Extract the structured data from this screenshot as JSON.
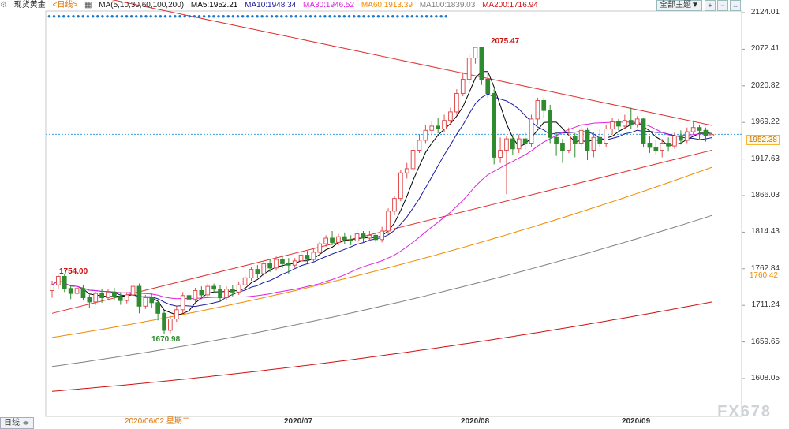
{
  "header": {
    "symbol": "现货黄金",
    "period": "<日线>",
    "ma_label": "MA(5,10,30,60,100,200)",
    "ma5": "MA5:1952.21",
    "ma10": "MA10:1948.34",
    "ma30": "MA30:1946.52",
    "ma60": "MA60:1913.39",
    "ma100": "MA100:1839.03",
    "ma200": "MA200:1716.94",
    "theme_button": "全部主题▼",
    "colors": {
      "ma5": "#000000",
      "ma10": "#1a1aa0",
      "ma30": "#e020e0",
      "ma60": "#f08a00",
      "ma100": "#808080",
      "ma200": "#d01010",
      "up": "#e05050",
      "down": "#2e8b2e"
    }
  },
  "chart_data": {
    "type": "candlestick",
    "y_ticks": [
      "2124.01",
      "2072.41",
      "2020.82",
      "1969.22",
      "1917.63",
      "1866.03",
      "1814.43",
      "1762.84",
      "1711.24",
      "1659.65",
      "1608.05"
    ],
    "ylim": [
      1608.05,
      2124.01
    ],
    "x_labels": [
      "2020/07",
      "2020/08",
      "2020/09"
    ],
    "cursor_date": "2020/06/02 星期二",
    "current_price": "1952.38",
    "ma60_tag": "1760.42",
    "annotations": {
      "high": "2075.47",
      "low": "1670.98",
      "local_high": "1754.00"
    },
    "candles": [
      [
        1732,
        1740,
        1722,
        1746
      ],
      [
        1740,
        1752,
        1735,
        1754
      ],
      [
        1752,
        1735,
        1730,
        1755
      ],
      [
        1735,
        1728,
        1720,
        1740
      ],
      [
        1728,
        1735,
        1722,
        1740
      ],
      [
        1735,
        1722,
        1718,
        1740
      ],
      [
        1722,
        1716,
        1708,
        1726
      ],
      [
        1716,
        1728,
        1712,
        1730
      ],
      [
        1728,
        1722,
        1715,
        1734
      ],
      [
        1722,
        1730,
        1718,
        1734
      ],
      [
        1730,
        1724,
        1718,
        1736
      ],
      [
        1724,
        1718,
        1712,
        1730
      ],
      [
        1718,
        1726,
        1714,
        1730
      ],
      [
        1726,
        1738,
        1722,
        1742
      ],
      [
        1738,
        1710,
        1700,
        1742
      ],
      [
        1710,
        1722,
        1706,
        1726
      ],
      [
        1722,
        1715,
        1708,
        1728
      ],
      [
        1715,
        1700,
        1690,
        1718
      ],
      [
        1700,
        1676,
        1671,
        1704
      ],
      [
        1676,
        1692,
        1672,
        1696
      ],
      [
        1692,
        1705,
        1688,
        1710
      ],
      [
        1705,
        1725,
        1700,
        1730
      ],
      [
        1725,
        1720,
        1712,
        1730
      ],
      [
        1720,
        1732,
        1716,
        1736
      ],
      [
        1732,
        1726,
        1720,
        1738
      ],
      [
        1726,
        1738,
        1722,
        1742
      ],
      [
        1738,
        1734,
        1728,
        1742
      ],
      [
        1734,
        1722,
        1716,
        1740
      ],
      [
        1722,
        1734,
        1718,
        1738
      ],
      [
        1734,
        1730,
        1724,
        1740
      ],
      [
        1730,
        1740,
        1726,
        1744
      ],
      [
        1740,
        1750,
        1736,
        1754
      ],
      [
        1750,
        1762,
        1746,
        1766
      ],
      [
        1762,
        1756,
        1750,
        1768
      ],
      [
        1756,
        1770,
        1752,
        1774
      ],
      [
        1770,
        1764,
        1758,
        1776
      ],
      [
        1764,
        1776,
        1760,
        1780
      ],
      [
        1776,
        1770,
        1764,
        1782
      ],
      [
        1770,
        1768,
        1756,
        1778
      ],
      [
        1768,
        1774,
        1764,
        1778
      ],
      [
        1774,
        1782,
        1770,
        1786
      ],
      [
        1782,
        1776,
        1770,
        1788
      ],
      [
        1776,
        1786,
        1772,
        1792
      ],
      [
        1786,
        1798,
        1782,
        1802
      ],
      [
        1798,
        1806,
        1794,
        1810
      ],
      [
        1806,
        1800,
        1796,
        1816
      ],
      [
        1800,
        1808,
        1796,
        1812
      ],
      [
        1808,
        1804,
        1798,
        1814
      ],
      [
        1804,
        1802,
        1796,
        1810
      ],
      [
        1802,
        1812,
        1798,
        1818
      ],
      [
        1812,
        1806,
        1800,
        1816
      ],
      [
        1806,
        1810,
        1802,
        1816
      ],
      [
        1810,
        1804,
        1800,
        1814
      ],
      [
        1804,
        1816,
        1800,
        1822
      ],
      [
        1816,
        1844,
        1812,
        1848
      ],
      [
        1844,
        1862,
        1838,
        1866
      ],
      [
        1862,
        1898,
        1858,
        1902
      ],
      [
        1898,
        1904,
        1890,
        1912
      ],
      [
        1904,
        1930,
        1900,
        1936
      ],
      [
        1930,
        1944,
        1926,
        1952
      ],
      [
        1944,
        1958,
        1940,
        1966
      ],
      [
        1958,
        1964,
        1950,
        1972
      ],
      [
        1964,
        1960,
        1954,
        1976
      ],
      [
        1960,
        1972,
        1956,
        1980
      ],
      [
        1972,
        1984,
        1966,
        1990
      ],
      [
        1984,
        2010,
        1980,
        2016
      ],
      [
        2010,
        2030,
        2006,
        2040
      ],
      [
        2030,
        2060,
        2024,
        2066
      ],
      [
        2060,
        2075,
        2052,
        2076
      ],
      [
        2075,
        2030,
        2022,
        2070
      ],
      [
        2030,
        2010,
        2004,
        2040
      ],
      [
        2010,
        1920,
        1910,
        2016
      ],
      [
        1920,
        1930,
        1912,
        1948
      ],
      [
        1930,
        1946,
        1868,
        1950
      ],
      [
        1946,
        1932,
        1924,
        1952
      ],
      [
        1932,
        1946,
        1926,
        1952
      ],
      [
        1946,
        1940,
        1930,
        1956
      ],
      [
        1940,
        1974,
        1934,
        1980
      ],
      [
        1974,
        2000,
        1966,
        2004
      ],
      [
        2000,
        1986,
        1976,
        2004
      ],
      [
        1986,
        1948,
        1940,
        1994
      ],
      [
        1948,
        1940,
        1922,
        1956
      ],
      [
        1940,
        1930,
        1912,
        1946
      ],
      [
        1930,
        1950,
        1926,
        1962
      ],
      [
        1950,
        1940,
        1920,
        1954
      ],
      [
        1940,
        1958,
        1934,
        1966
      ],
      [
        1958,
        1930,
        1916,
        1962
      ],
      [
        1930,
        1948,
        1920,
        1956
      ],
      [
        1948,
        1940,
        1934,
        1960
      ],
      [
        1940,
        1960,
        1934,
        1966
      ],
      [
        1960,
        1970,
        1952,
        1976
      ],
      [
        1970,
        1964,
        1958,
        1974
      ],
      [
        1964,
        1972,
        1960,
        1980
      ],
      [
        1972,
        1966,
        1960,
        1990
      ],
      [
        1966,
        1974,
        1962,
        1978
      ],
      [
        1974,
        1940,
        1934,
        1976
      ],
      [
        1940,
        1934,
        1926,
        1950
      ],
      [
        1934,
        1930,
        1924,
        1944
      ],
      [
        1930,
        1940,
        1920,
        1946
      ],
      [
        1940,
        1936,
        1928,
        1948
      ],
      [
        1936,
        1950,
        1932,
        1956
      ],
      [
        1950,
        1944,
        1938,
        1958
      ],
      [
        1944,
        1956,
        1940,
        1962
      ],
      [
        1956,
        1962,
        1952,
        1972
      ],
      [
        1962,
        1958,
        1946,
        1966
      ],
      [
        1958,
        1950,
        1942,
        1962
      ],
      [
        1950,
        1952,
        1944,
        1956
      ]
    ],
    "trendlines": [
      {
        "name": "upper",
        "from": [
          0,
          2160
        ],
        "to": [
          106,
          1965
        ]
      },
      {
        "name": "lower",
        "from": [
          0,
          1700
        ],
        "to": [
          106,
          1930
        ]
      }
    ]
  },
  "footer": {
    "tab": "日线",
    "watermark": "FX678"
  }
}
